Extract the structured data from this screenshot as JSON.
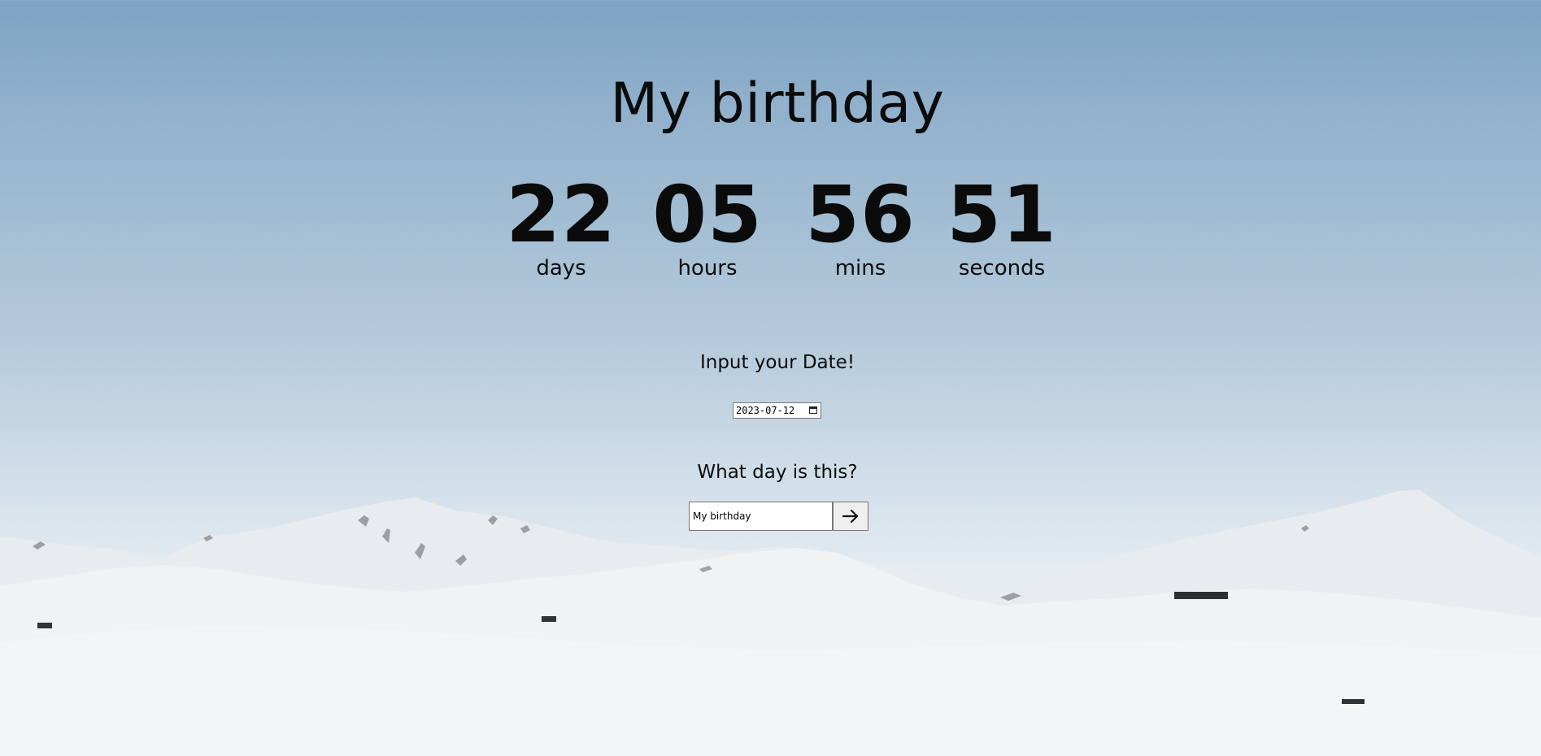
{
  "title": "My birthday",
  "countdown": {
    "days": {
      "value": "22",
      "label": "days"
    },
    "hours": {
      "value": "05",
      "label": "hours"
    },
    "mins": {
      "value": "56",
      "label": "mins"
    },
    "seconds": {
      "value": "51",
      "label": "seconds"
    }
  },
  "date_section": {
    "prompt": "Input your Date!",
    "date_value": "2023-07-12",
    "calendar_icon": "calendar-icon"
  },
  "name_section": {
    "prompt": "What day is this?",
    "name_value": "My birthday",
    "submit_icon": "arrow-right-icon"
  },
  "colors": {
    "text": "#0b0b0b",
    "sky_top": "#7fa3c4",
    "sky_bottom": "#cfdde8",
    "snow": "#eef0f2",
    "button_bg": "#efefef"
  }
}
